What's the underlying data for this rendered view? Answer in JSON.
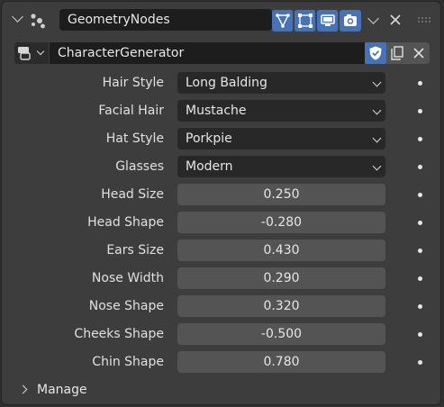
{
  "header": {
    "modifier_name": "GeometryNodes",
    "node_group_name": "CharacterGenerator"
  },
  "properties": [
    {
      "label": "Hair Style",
      "type": "dropdown",
      "value": "Long Balding"
    },
    {
      "label": "Facial Hair",
      "type": "dropdown",
      "value": "Mustache"
    },
    {
      "label": "Hat Style",
      "type": "dropdown",
      "value": "Porkpie"
    },
    {
      "label": "Glasses",
      "type": "dropdown",
      "value": "Modern"
    },
    {
      "label": "Head Size",
      "type": "number",
      "value": "0.250"
    },
    {
      "label": "Head Shape",
      "type": "number",
      "value": "-0.280"
    },
    {
      "label": "Ears Size",
      "type": "number",
      "value": "0.430"
    },
    {
      "label": "Nose Width",
      "type": "number",
      "value": "0.290"
    },
    {
      "label": "Nose Shape",
      "type": "number",
      "value": "0.320"
    },
    {
      "label": "Cheeks Shape",
      "type": "number",
      "value": "-0.500"
    },
    {
      "label": "Chin Shape",
      "type": "number",
      "value": "0.780"
    }
  ],
  "manage": {
    "label": "Manage"
  },
  "colors": {
    "accent": "#4772b3",
    "panel": "#3d3d3d",
    "field": "#545454"
  }
}
